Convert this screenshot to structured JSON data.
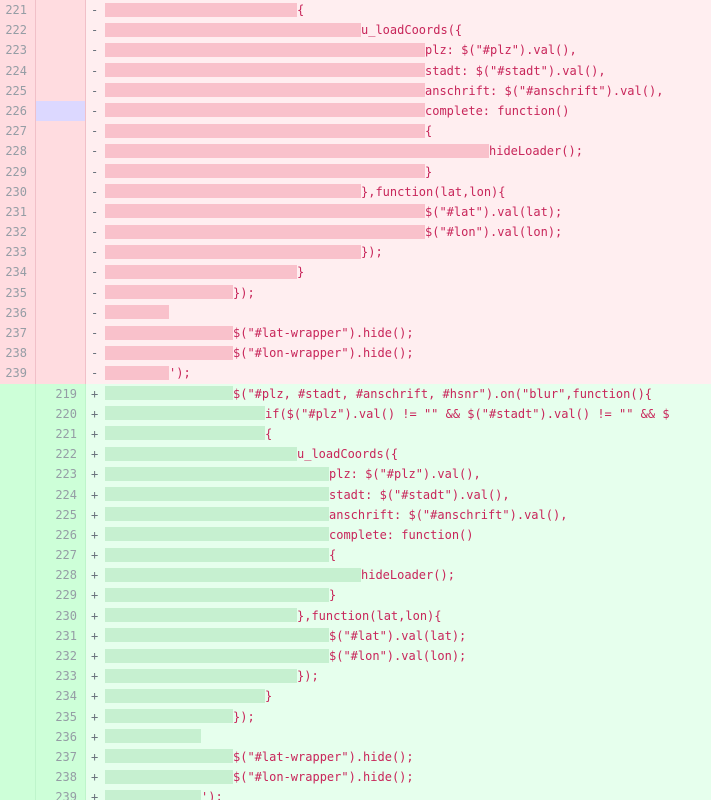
{
  "diff": {
    "colors": {
      "deleted_bg": "#ffeef0",
      "added_bg": "#e6ffed",
      "code_text": "#c8265a",
      "selected_gutter": "#dcd8ff"
    },
    "deleted": [
      {
        "old": "221",
        "indent": 24,
        "text": "{"
      },
      {
        "old": "222",
        "indent": 32,
        "text": "u_loadCoords({"
      },
      {
        "old": "223",
        "indent": 40,
        "text": "plz: $(\"#plz\").val(),"
      },
      {
        "old": "224",
        "indent": 40,
        "text": "stadt: $(\"#stadt\").val(),"
      },
      {
        "old": "225",
        "indent": 40,
        "text": "anschrift: $(\"#anschrift\").val(),"
      },
      {
        "old": "226",
        "indent": 40,
        "text": "complete: function()",
        "selected": true
      },
      {
        "old": "227",
        "indent": 40,
        "text": "{"
      },
      {
        "old": "228",
        "indent": 48,
        "text": "hideLoader();"
      },
      {
        "old": "229",
        "indent": 40,
        "text": "}"
      },
      {
        "old": "230",
        "indent": 32,
        "text": "},function(lat,lon){"
      },
      {
        "old": "231",
        "indent": 40,
        "text": "$(\"#lat\").val(lat);"
      },
      {
        "old": "232",
        "indent": 40,
        "text": "$(\"#lon\").val(lon);"
      },
      {
        "old": "233",
        "indent": 32,
        "text": "});"
      },
      {
        "old": "234",
        "indent": 24,
        "text": "}"
      },
      {
        "old": "235",
        "indent": 16,
        "text": "});"
      },
      {
        "old": "236",
        "indent": 8,
        "text": ""
      },
      {
        "old": "237",
        "indent": 16,
        "text": "$(\"#lat-wrapper\").hide();"
      },
      {
        "old": "238",
        "indent": 16,
        "text": "$(\"#lon-wrapper\").hide();"
      },
      {
        "old": "239",
        "indent": 8,
        "text": "');"
      }
    ],
    "added": [
      {
        "new": "219",
        "indent": 16,
        "text": "$(\"#plz, #stadt, #anschrift, #hsnr\").on(\"blur\",function(){"
      },
      {
        "new": "220",
        "indent": 20,
        "text": "if($(\"#plz\").val() != \"\" && $(\"#stadt\").val() != \"\" && $"
      },
      {
        "new": "221",
        "indent": 20,
        "text": "{"
      },
      {
        "new": "222",
        "indent": 24,
        "text": "u_loadCoords({"
      },
      {
        "new": "223",
        "indent": 28,
        "text": "plz: $(\"#plz\").val(),"
      },
      {
        "new": "224",
        "indent": 28,
        "text": "stadt: $(\"#stadt\").val(),"
      },
      {
        "new": "225",
        "indent": 28,
        "text": "anschrift: $(\"#anschrift\").val(),"
      },
      {
        "new": "226",
        "indent": 28,
        "text": "complete: function()"
      },
      {
        "new": "227",
        "indent": 28,
        "text": "{"
      },
      {
        "new": "228",
        "indent": 32,
        "text": "hideLoader();"
      },
      {
        "new": "229",
        "indent": 28,
        "text": "}"
      },
      {
        "new": "230",
        "indent": 24,
        "text": "},function(lat,lon){"
      },
      {
        "new": "231",
        "indent": 28,
        "text": "$(\"#lat\").val(lat);"
      },
      {
        "new": "232",
        "indent": 28,
        "text": "$(\"#lon\").val(lon);"
      },
      {
        "new": "233",
        "indent": 24,
        "text": "});"
      },
      {
        "new": "234",
        "indent": 20,
        "text": "}"
      },
      {
        "new": "235",
        "indent": 16,
        "text": "});"
      },
      {
        "new": "236",
        "indent": 12,
        "text": ""
      },
      {
        "new": "237",
        "indent": 16,
        "text": "$(\"#lat-wrapper\").hide();"
      },
      {
        "new": "238",
        "indent": 16,
        "text": "$(\"#lon-wrapper\").hide();"
      },
      {
        "new": "239",
        "indent": 12,
        "text": "');"
      }
    ],
    "sign_deleted": "-",
    "sign_added": "+"
  }
}
